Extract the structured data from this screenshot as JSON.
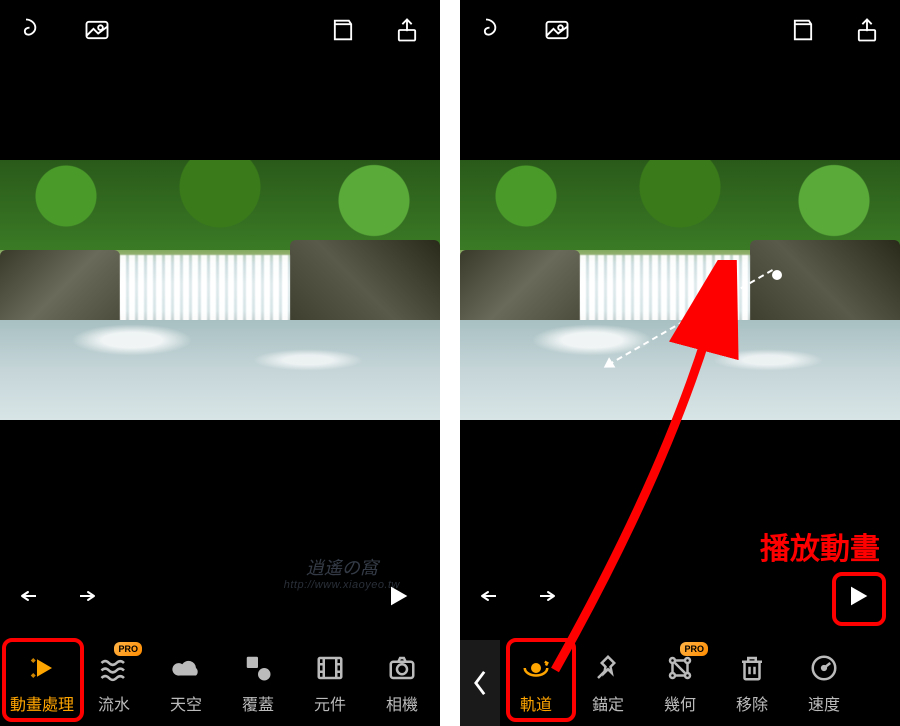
{
  "top_icons": [
    {
      "name": "swirl-icon"
    },
    {
      "name": "photo-icon"
    },
    {
      "name": "album-icon"
    },
    {
      "name": "share-icon"
    }
  ],
  "left": {
    "tools": [
      {
        "key": "animation",
        "label": "動畫處理",
        "icon": "sparkle-play",
        "active": true,
        "pro": false
      },
      {
        "key": "water",
        "label": "流水",
        "icon": "wave",
        "active": false,
        "pro": true
      },
      {
        "key": "sky",
        "label": "天空",
        "icon": "cloud",
        "active": false,
        "pro": false
      },
      {
        "key": "overlay",
        "label": "覆蓋",
        "icon": "shapes",
        "active": false,
        "pro": false
      },
      {
        "key": "element",
        "label": "元件",
        "icon": "film",
        "active": false,
        "pro": false
      },
      {
        "key": "camera",
        "label": "相機",
        "icon": "camera",
        "active": false,
        "pro": false
      }
    ]
  },
  "right": {
    "back": true,
    "annotation_label": "播放動畫",
    "tools": [
      {
        "key": "track",
        "label": "軌道",
        "icon": "orbit",
        "active": true,
        "pro": false
      },
      {
        "key": "anchor",
        "label": "錨定",
        "icon": "pin",
        "active": false,
        "pro": false
      },
      {
        "key": "geom",
        "label": "幾何",
        "icon": "graph",
        "active": false,
        "pro": true
      },
      {
        "key": "remove",
        "label": "移除",
        "icon": "trash",
        "active": false,
        "pro": false
      },
      {
        "key": "speed",
        "label": "速度",
        "icon": "gauge",
        "active": false,
        "pro": false
      }
    ]
  },
  "watermark": {
    "title": "逍遙の窩",
    "sub": "http://www.xiaoyeo.tw"
  },
  "pro_label": "PRO"
}
